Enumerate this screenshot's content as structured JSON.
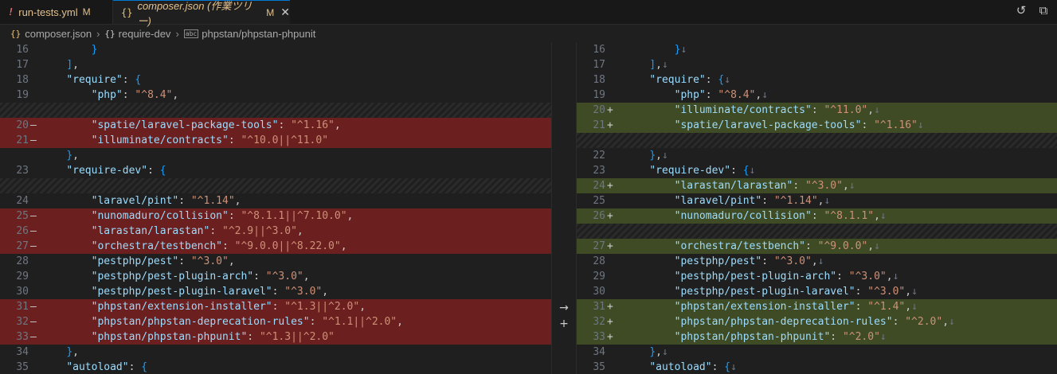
{
  "tabs": [
    {
      "icon": "!",
      "label": "run-tests.yml",
      "status": "M"
    },
    {
      "icon": "{}",
      "label": "composer.json (作業ツリー)",
      "status": "M",
      "close": "✕"
    }
  ],
  "top_icons": [
    "history-icon",
    "open-file-icon"
  ],
  "breadcrumb": {
    "file_icon": "{}",
    "file": "composer.json",
    "sep1": "›",
    "obj_icon": "{}",
    "obj": "require-dev",
    "sep2": "›",
    "leaf_icon": "abc",
    "leaf": "phpstan/phpstan-phpunit"
  },
  "gutter_buttons": [
    "→",
    "+"
  ],
  "left": [
    {
      "n": "16",
      "t": "normal",
      "code": "        }"
    },
    {
      "n": "17",
      "t": "normal",
      "code": "    ],"
    },
    {
      "n": "18",
      "t": "normal",
      "code": "    \"require\": {"
    },
    {
      "n": "19",
      "t": "normal",
      "code": "        \"php\": \"^8.4\","
    },
    {
      "n": "",
      "t": "hatch",
      "code": ""
    },
    {
      "n": "20",
      "t": "del",
      "code": "        \"spatie/laravel-package-tools\": \"^1.16\","
    },
    {
      "n": "21",
      "t": "del",
      "code": "        \"illuminate/contracts\": \"^10.0||^11.0\""
    },
    {
      "n": "",
      "t": "normal",
      "code": "    },"
    },
    {
      "n": "23",
      "t": "normal",
      "code": "    \"require-dev\": {"
    },
    {
      "n": "",
      "t": "hatch",
      "code": ""
    },
    {
      "n": "24",
      "t": "normal",
      "code": "        \"laravel/pint\": \"^1.14\","
    },
    {
      "n": "25",
      "t": "del",
      "code": "        \"nunomaduro/collision\": \"^8.1.1||^7.10.0\","
    },
    {
      "n": "26",
      "t": "del",
      "code": "        \"larastan/larastan\": \"^2.9||^3.0\","
    },
    {
      "n": "27",
      "t": "del",
      "code": "        \"orchestra/testbench\": \"^9.0.0||^8.22.0\","
    },
    {
      "n": "28",
      "t": "normal",
      "code": "        \"pestphp/pest\": \"^3.0\","
    },
    {
      "n": "29",
      "t": "normal",
      "code": "        \"pestphp/pest-plugin-arch\": \"^3.0\","
    },
    {
      "n": "30",
      "t": "normal",
      "code": "        \"pestphp/pest-plugin-laravel\": \"^3.0\","
    },
    {
      "n": "31",
      "t": "del",
      "code": "        \"phpstan/extension-installer\": \"^1.3||^2.0\","
    },
    {
      "n": "32",
      "t": "del",
      "code": "        \"phpstan/phpstan-deprecation-rules\": \"^1.1||^2.0\","
    },
    {
      "n": "33",
      "t": "del",
      "code": "        \"phpstan/phpstan-phpunit\": \"^1.3||^2.0\""
    },
    {
      "n": "34",
      "t": "normal",
      "code": "    },"
    },
    {
      "n": "35",
      "t": "normal",
      "code": "    \"autoload\": {"
    }
  ],
  "right": [
    {
      "n": "16",
      "t": "normal",
      "code": "        }↓"
    },
    {
      "n": "17",
      "t": "normal",
      "code": "    ],↓"
    },
    {
      "n": "18",
      "t": "normal",
      "code": "    \"require\": {↓"
    },
    {
      "n": "19",
      "t": "normal",
      "code": "        \"php\": \"^8.4\",↓"
    },
    {
      "n": "20",
      "t": "ins",
      "code": "        \"illuminate/contracts\": \"^11.0\",↓"
    },
    {
      "n": "21",
      "t": "ins",
      "code": "        \"spatie/laravel-package-tools\": \"^1.16\"↓"
    },
    {
      "n": "",
      "t": "hatch",
      "code": ""
    },
    {
      "n": "22",
      "t": "normal",
      "code": "    },↓"
    },
    {
      "n": "23",
      "t": "normal",
      "code": "    \"require-dev\": {↓"
    },
    {
      "n": "24",
      "t": "ins",
      "code": "        \"larastan/larastan\": \"^3.0\",↓"
    },
    {
      "n": "25",
      "t": "normal",
      "code": "        \"laravel/pint\": \"^1.14\",↓"
    },
    {
      "n": "26",
      "t": "ins",
      "code": "        \"nunomaduro/collision\": \"^8.1.1\",↓"
    },
    {
      "n": "",
      "t": "hatch",
      "code": ""
    },
    {
      "n": "27",
      "t": "ins",
      "code": "        \"orchestra/testbench\": \"^9.0.0\",↓"
    },
    {
      "n": "28",
      "t": "normal",
      "code": "        \"pestphp/pest\": \"^3.0\",↓"
    },
    {
      "n": "29",
      "t": "normal",
      "code": "        \"pestphp/pest-plugin-arch\": \"^3.0\",↓"
    },
    {
      "n": "30",
      "t": "normal",
      "code": "        \"pestphp/pest-plugin-laravel\": \"^3.0\",↓"
    },
    {
      "n": "31",
      "t": "ins",
      "code": "        \"phpstan/extension-installer\": \"^1.4\",↓"
    },
    {
      "n": "32",
      "t": "ins",
      "code": "        \"phpstan/phpstan-deprecation-rules\": \"^2.0\",↓"
    },
    {
      "n": "33",
      "t": "ins",
      "code": "        \"phpstan/phpstan-phpunit\": \"^2.0\"↓"
    },
    {
      "n": "34",
      "t": "normal",
      "code": "    },↓"
    },
    {
      "n": "35",
      "t": "normal",
      "code": "    \"autoload\": {↓"
    }
  ]
}
